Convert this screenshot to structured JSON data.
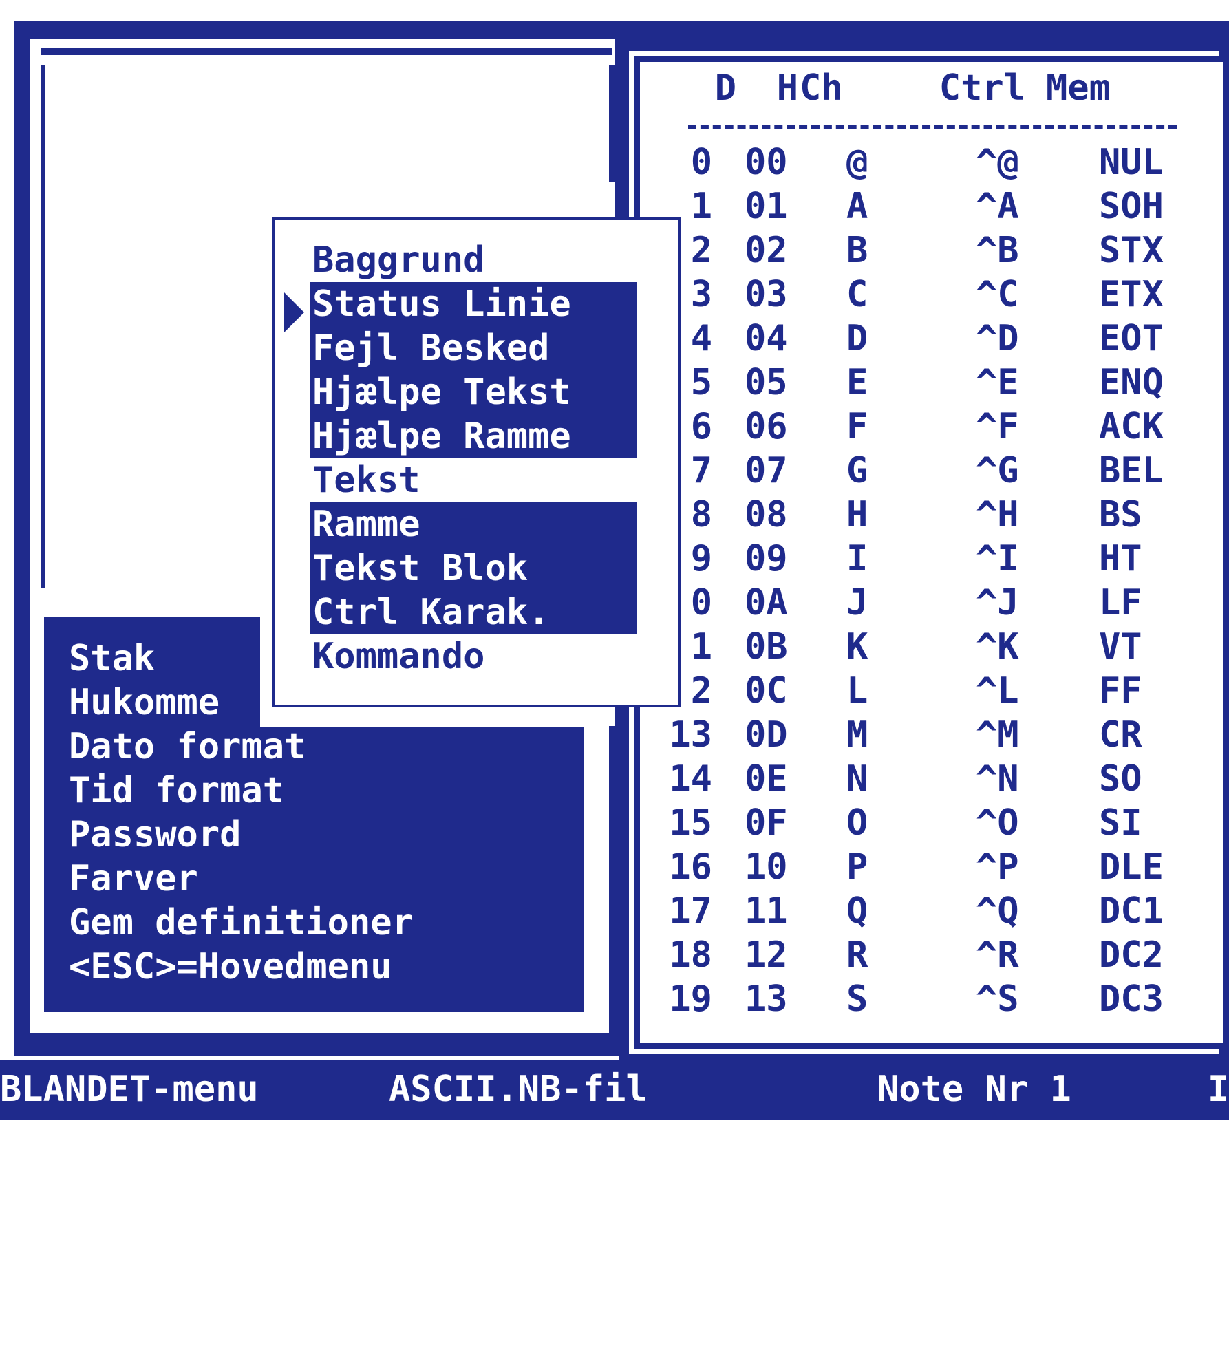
{
  "color_menu": {
    "items": [
      {
        "label": "Baggrund",
        "highlighted": false
      },
      {
        "label": "Status Linie",
        "highlighted": true,
        "current": true
      },
      {
        "label": "Fejl Besked",
        "highlighted": true
      },
      {
        "label": "Hjælpe Tekst",
        "highlighted": true
      },
      {
        "label": "Hjælpe Ramme",
        "highlighted": true
      },
      {
        "label": "Tekst",
        "highlighted": false
      },
      {
        "label": "Ramme",
        "highlighted": true
      },
      {
        "label": "Tekst Blok",
        "highlighted": true
      },
      {
        "label": "Ctrl Karak.",
        "highlighted": true
      },
      {
        "label": "Kommando",
        "highlighted": false
      }
    ],
    "pointer_icon": "triangle-right-icon"
  },
  "settings_menu": {
    "items": [
      "Stak",
      "Hukomme",
      "Dato format",
      "Tid format",
      "Password",
      "Farver",
      "Gem definitioner",
      "<ESC>=Hovedmenu"
    ]
  },
  "ascii_table": {
    "headers": {
      "d": "D",
      "h": "H",
      "ch": "Ch",
      "ctrl": "Ctrl",
      "mem": "Mem"
    },
    "rule": "-----------------------",
    "rows": [
      [
        "0",
        "00",
        "@",
        "^@",
        "NUL"
      ],
      [
        "1",
        "01",
        "A",
        "^A",
        "SOH"
      ],
      [
        "2",
        "02",
        "B",
        "^B",
        "STX"
      ],
      [
        "3",
        "03",
        "C",
        "^C",
        "ETX"
      ],
      [
        "4",
        "04",
        "D",
        "^D",
        "EOT"
      ],
      [
        "5",
        "05",
        "E",
        "^E",
        "ENQ"
      ],
      [
        "6",
        "06",
        "F",
        "^F",
        "ACK"
      ],
      [
        "7",
        "07",
        "G",
        "^G",
        "BEL"
      ],
      [
        "8",
        "08",
        "H",
        "^H",
        "BS"
      ],
      [
        "9",
        "09",
        "I",
        "^I",
        "HT"
      ],
      [
        "0",
        "0A",
        "J",
        "^J",
        "LF"
      ],
      [
        "1",
        "0B",
        "K",
        "^K",
        "VT"
      ],
      [
        "2",
        "0C",
        "L",
        "^L",
        "FF"
      ],
      [
        "13",
        "0D",
        "M",
        "^M",
        "CR"
      ],
      [
        "14",
        "0E",
        "N",
        "^N",
        "SO"
      ],
      [
        "15",
        "0F",
        "O",
        "^O",
        "SI"
      ],
      [
        "16",
        "10",
        "P",
        "^P",
        "DLE"
      ],
      [
        "17",
        "11",
        "Q",
        "^Q",
        "DC1"
      ],
      [
        "18",
        "12",
        "R",
        "^R",
        "DC2"
      ],
      [
        "19",
        "13",
        "S",
        "^S",
        "DC3"
      ]
    ]
  },
  "status_bar": {
    "menu": "BLANDET-menu",
    "file": "ASCII.NB-fil",
    "note": "Note Nr 1",
    "trailing": "I"
  },
  "colors": {
    "navy": "#1f2a8c",
    "background": "#ffffff"
  }
}
